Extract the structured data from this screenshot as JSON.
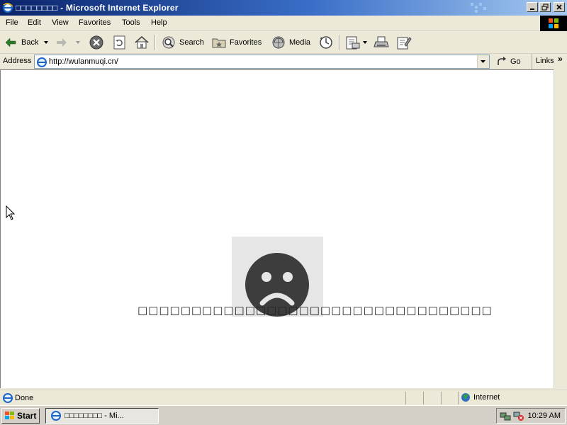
{
  "window": {
    "title": "□□□□□□□□ - Microsoft Internet Explorer"
  },
  "menu": {
    "items": [
      "File",
      "Edit",
      "View",
      "Favorites",
      "Tools",
      "Help"
    ]
  },
  "toolbar": {
    "back_label": "Back",
    "search_label": "Search",
    "favorites_label": "Favorites",
    "media_label": "Media"
  },
  "address": {
    "label": "Address",
    "url": "http://wulanmuqi.cn/",
    "go_label": "Go",
    "links_label": "Links",
    "links_chevron": "»"
  },
  "page": {
    "error_message": "□□□□□□□□□□□□□□□□□□□□□□□□□□□□□□□□□"
  },
  "status": {
    "text": "Done",
    "zone": "Internet"
  },
  "taskbar": {
    "start_label": "Start",
    "task_label": "□□□□□□□□ - Mi...",
    "clock": "10:29 AM"
  },
  "icons": {
    "app": "ie-icon",
    "back": "back-arrow-icon",
    "forward": "forward-arrow-icon",
    "stop": "stop-icon",
    "refresh": "refresh-icon",
    "home": "home-icon",
    "search": "search-icon",
    "favorites": "favorites-icon",
    "media": "media-icon",
    "history": "history-icon",
    "mail": "mail-icon",
    "print": "print-icon",
    "edit": "edit-icon",
    "sad_face": "sad-face-icon"
  },
  "colors": {
    "titlebar_start": "#0a246a",
    "titlebar_end": "#a6caf0",
    "chrome": "#ece9d8",
    "sad_face": "#3d3d3d",
    "sad_box": "#e6e6e6"
  }
}
